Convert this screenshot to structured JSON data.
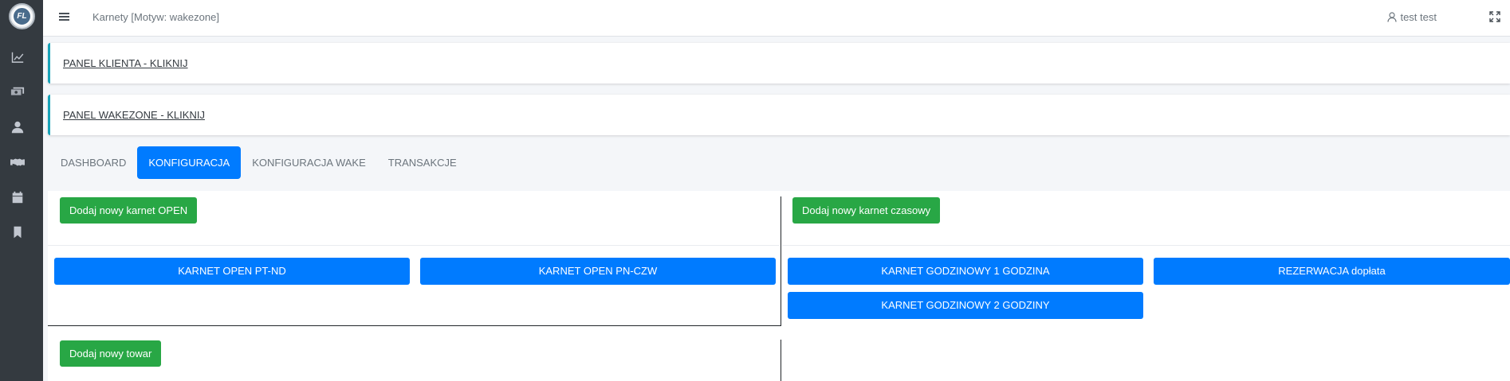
{
  "sidebar": {
    "logo_text": "FL",
    "icons": [
      "chart-line-icon",
      "money-icon",
      "user-icon",
      "handshake-icon",
      "calendar-icon",
      "bookmark-icon"
    ]
  },
  "header": {
    "title": "Karnety [Motyw: wakezone]",
    "user_name": "test test"
  },
  "panels": {
    "client": "PANEL KLIENTA - KLIKNIJ",
    "wakezone": "PANEL WAKEZONE - KLIKNIJ"
  },
  "tabs": [
    {
      "label": "DASHBOARD",
      "active": false
    },
    {
      "label": "KONFIGURACJA",
      "active": true
    },
    {
      "label": "KONFIGURACJA WAKE",
      "active": false
    },
    {
      "label": "TRANSAKCJE",
      "active": false
    }
  ],
  "content": {
    "add_open_label": "Dodaj nowy karnet OPEN",
    "add_time_label": "Dodaj nowy karnet czasowy",
    "add_product_label": "Dodaj nowy towar",
    "open_passes": [
      "KARNET OPEN PT-ND",
      "KARNET OPEN PN-CZW"
    ],
    "time_passes": [
      "KARNET GODZINOWY 1 GODZINA",
      "REZERWACJA dopłata",
      "KARNET GODZINOWY 2 GODZINY"
    ]
  },
  "colors": {
    "sidebar_bg": "#343a40",
    "primary": "#007bff",
    "success": "#28a745",
    "panel_accent": "#17a2b8"
  }
}
